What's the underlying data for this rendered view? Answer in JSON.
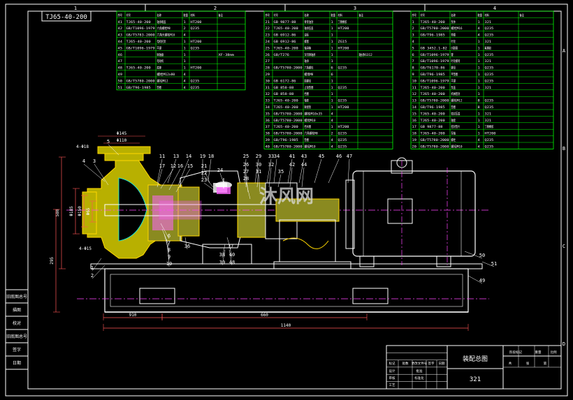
{
  "drawing": {
    "code": "TJ65-40-200",
    "title": "装配总图",
    "material_no": "321",
    "watermark": "沐风网"
  },
  "colors": {
    "background": "#000000",
    "frame": "#ffffff",
    "table_line": "#00ff00",
    "text": "#ffffff",
    "part_fill": "#b8b000",
    "motor": "#ffffff",
    "dimension": "#ff4444",
    "center_line": "#ff44ff",
    "cyan": "#00ffff"
  },
  "grid": {
    "top": [
      "1",
      "2",
      "3",
      "4"
    ],
    "side": [
      "A",
      "B",
      "C",
      "D"
    ]
  },
  "left_titles": [
    "旧底图总号",
    "描图",
    "校对",
    "旧底图总号",
    "签字",
    "日期"
  ],
  "bom_headers": [
    "序号",
    "代号",
    "名称",
    "数量",
    "材料",
    "备注"
  ],
  "bom_left": [
    [
      "41",
      "TJ65-40-200",
      "轴承端盖",
      "1",
      "HT200",
      ""
    ],
    [
      "42",
      "GB/T1096-1979",
      "六角螺栓M8",
      "2",
      "Q235",
      ""
    ],
    [
      "43",
      "GB/T5783-2000",
      "六角头螺栓M10",
      "4",
      "",
      ""
    ],
    [
      "44",
      "TJ65-40-200",
      "电机托架",
      "1",
      "HT200",
      ""
    ],
    [
      "45",
      "GB/T1096-1979",
      "平键",
      "1",
      "Q235",
      ""
    ],
    [
      "46",
      "",
      "联轴器",
      "1",
      "",
      "XF-38mm"
    ],
    [
      "47",
      "",
      "电动机",
      "1",
      "",
      ""
    ],
    [
      "48",
      "TJ65-40-200",
      "底座",
      "1",
      "HT200",
      ""
    ],
    [
      "49",
      "",
      "螺栓M12x80",
      "4",
      "",
      ""
    ],
    [
      "50",
      "GB/T5780-2000",
      "螺母M12",
      "4",
      "Q235",
      ""
    ],
    [
      "51",
      "GB/T96-1985",
      "垫圈",
      "4",
      "Q235",
      ""
    ]
  ],
  "bom_mid": [
    [
      "21",
      "GB 9877-88",
      "骨架油封",
      "1",
      "丁腈橡胶",
      ""
    ],
    [
      "22",
      "TJ65-40-200",
      "轴承压盖",
      "1",
      "HT200",
      ""
    ],
    [
      "23",
      "GB 6912-86",
      "油标",
      "1",
      "",
      ""
    ],
    [
      "24",
      "GB 6912-86",
      "螺塞",
      "1",
      "ZG15",
      ""
    ],
    [
      "25",
      "TJ65-40-200",
      "轴承箱",
      "1",
      "HT200",
      ""
    ],
    [
      "26",
      "GB/T276",
      "深沟球轴承",
      "1",
      "",
      "轴承6312"
    ],
    [
      "27",
      "",
      "轴承",
      "1",
      "",
      ""
    ],
    [
      "28",
      "GB/T5780-2000",
      "六角螺栓",
      "6",
      "Q235",
      ""
    ],
    [
      "29",
      "",
      "螺母M8",
      "6",
      "",
      ""
    ],
    [
      "30",
      "GB 6172-86",
      "圆螺母",
      "1",
      "",
      ""
    ],
    [
      "31",
      "GB 858-88",
      "止动垫圈",
      "1",
      "Q235",
      ""
    ],
    [
      "32",
      "GB 858-88",
      "挡圈",
      "1",
      "",
      ""
    ],
    [
      "33",
      "TJ65-40-200",
      "轴套",
      "1",
      "Q235",
      ""
    ],
    [
      "34",
      "TJ65-40-200",
      "联接架",
      "1",
      "HT200",
      ""
    ],
    [
      "35",
      "GB/T5780-2000",
      "螺栓M10x35",
      "4",
      "",
      ""
    ],
    [
      "36",
      "GB/T5780-2000",
      "螺母M10",
      "4",
      "",
      ""
    ],
    [
      "37",
      "TJ65-40-200",
      "挡水圈",
      "1",
      "HT200",
      ""
    ],
    [
      "38",
      "GB/T5780-2000",
      "六角螺栓M8",
      "2",
      "Q235",
      ""
    ],
    [
      "39",
      "GB/T96-1985",
      "垫圈",
      "4",
      "Q235",
      ""
    ],
    [
      "40",
      "GB/T5780-2000",
      "螺母M10",
      "4",
      "Q235",
      ""
    ]
  ],
  "bom_right": [
    [
      "1",
      "TJ65-40-200",
      "泵体",
      "1",
      "321",
      ""
    ],
    [
      "2",
      "GB/T5780-2000",
      "螺栓M16",
      "4",
      "Q235",
      ""
    ],
    [
      "3",
      "GB/T96-1985",
      "垫圈",
      "4",
      "Q235",
      ""
    ],
    [
      "4",
      "",
      "叶轮",
      "1",
      "321",
      ""
    ],
    [
      "5",
      "GB 3452.1-82",
      "O型圈",
      "1",
      "氟橡胶",
      ""
    ],
    [
      "6",
      "GB/T1096-1979",
      "键",
      "1",
      "Q235",
      ""
    ],
    [
      "7",
      "GB/T1096-1979",
      "叶轮螺母",
      "1",
      "321",
      ""
    ],
    [
      "8",
      "GB/T6170-86",
      "螺母",
      "1",
      "Q235",
      ""
    ],
    [
      "9",
      "GB/T96-1985",
      "平垫圈",
      "1",
      "Q235",
      ""
    ],
    [
      "10",
      "GB/T1096-1979",
      "平键",
      "1",
      "Q235",
      ""
    ],
    [
      "11",
      "TJ65-40-200",
      "泵盖",
      "1",
      "321",
      ""
    ],
    [
      "12",
      "TJ65-40-200",
      "机械密封",
      "1",
      "",
      ""
    ],
    [
      "13",
      "GB/T5780-2000",
      "螺栓M12",
      "8",
      "Q235",
      ""
    ],
    [
      "14",
      "GB/T96-1985",
      "垫圈",
      "8",
      "Q235",
      ""
    ],
    [
      "15",
      "TJ65-40-200",
      "密封压盖",
      "1",
      "321",
      ""
    ],
    [
      "16",
      "TJ65-40-200",
      "轴套",
      "1",
      "321",
      ""
    ],
    [
      "17",
      "GB 9877-88",
      "密封垫片",
      "1",
      "丁腈橡胶",
      ""
    ],
    [
      "18",
      "TJ65-40-200",
      "泵轴",
      "1",
      "HT200",
      ""
    ],
    [
      "19",
      "GB/T5780-2000",
      "螺栓",
      "4",
      "Q235",
      ""
    ],
    [
      "20",
      "GB/T5780-2000",
      "螺母M10",
      "4",
      "Q235",
      ""
    ]
  ],
  "balloons": {
    "left_top": [
      "5",
      "11",
      "13",
      "14"
    ],
    "left_mid": [
      "4",
      "3",
      "17",
      "12",
      "16",
      "15",
      "19",
      "18"
    ],
    "center_top": [
      "21",
      "22",
      "23",
      "24"
    ],
    "right_top": [
      "25",
      "26",
      "27",
      "28",
      "29",
      "30",
      "31",
      "32",
      "33",
      "34",
      "35",
      "41",
      "42",
      "43",
      "44",
      "45",
      "46",
      "47"
    ],
    "lower": [
      "1",
      "2",
      "6",
      "7",
      "8",
      "9",
      "10",
      "36",
      "37",
      "38",
      "39",
      "40",
      "48",
      "49",
      "50",
      "51"
    ]
  },
  "dimensions": {
    "horizontal": [
      "910",
      "660",
      "1140"
    ],
    "vertical": [
      "580",
      "295"
    ],
    "diameters": [
      "Φ145",
      "Φ110",
      "Φ65",
      "Φ185",
      "Φ150",
      "4-Φ18",
      "4-Φ15"
    ]
  },
  "title_block": {
    "labels": [
      "标记",
      "处数",
      "更改文件号",
      "签字",
      "日期",
      "设计",
      "审核",
      "工艺",
      "批准",
      "标准化",
      "阶段标记",
      "重量",
      "比例",
      "共",
      "张",
      "第"
    ]
  }
}
